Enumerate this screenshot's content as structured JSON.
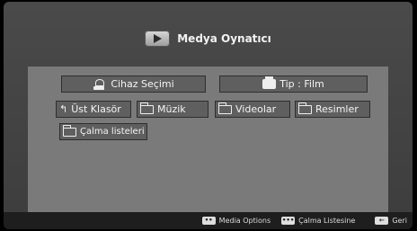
{
  "header": {
    "title": "Medya Oynatıcı",
    "icon": "play-icon"
  },
  "top_buttons": [
    {
      "label": "Cihaz Seçimi",
      "icon": "device-icon"
    },
    {
      "label": "Tip : Film",
      "icon": "media-type-icon"
    }
  ],
  "folder_buttons": [
    {
      "label": "Üst Klasör",
      "icon": "up-arrow-icon"
    },
    {
      "label": "Müzik",
      "icon": "folder-icon"
    },
    {
      "label": "Videolar",
      "icon": "folder-icon"
    },
    {
      "label": "Resimler",
      "icon": "folder-icon"
    },
    {
      "label": "Çalma listeleri",
      "icon": "folder-icon"
    }
  ],
  "footer": {
    "hints": [
      {
        "key": "••",
        "label": "Media Options"
      },
      {
        "key": "•••",
        "label": "Çalma Listesine"
      },
      {
        "key": "←",
        "label": "Geri"
      }
    ]
  }
}
